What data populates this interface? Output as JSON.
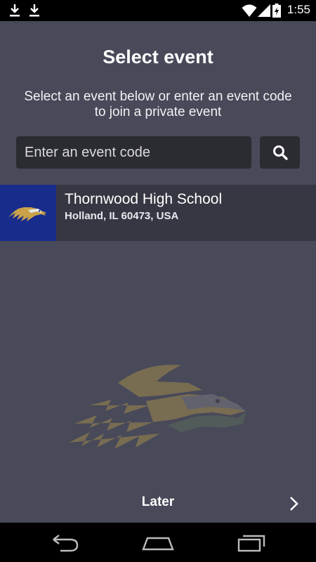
{
  "status_bar": {
    "time": "1:55",
    "icons": [
      "download-icon",
      "download-icon",
      "wifi-icon",
      "cell-signal-icon",
      "battery-charging-icon"
    ]
  },
  "header": {
    "title": "Select event",
    "subtitle": "Select an event below or enter an event code to join a private event"
  },
  "search": {
    "placeholder": "Enter an event code",
    "value": "",
    "button_icon": "search-icon"
  },
  "events": [
    {
      "name": "Thornwood High School",
      "location": "Holland, IL 60473, USA",
      "logo_icon": "eagle-logo-icon"
    }
  ],
  "footer": {
    "later_label": "Later",
    "chevron_icon": "chevron-right-icon"
  },
  "nav_bar": {
    "buttons": [
      "back-icon",
      "home-icon",
      "recents-icon"
    ]
  },
  "colors": {
    "background": "#484959",
    "input_bg": "#2b2b32",
    "event_row_bg": "#373743",
    "logo_blue": "#182c8c",
    "eagle_gold": "#c9a24a"
  }
}
